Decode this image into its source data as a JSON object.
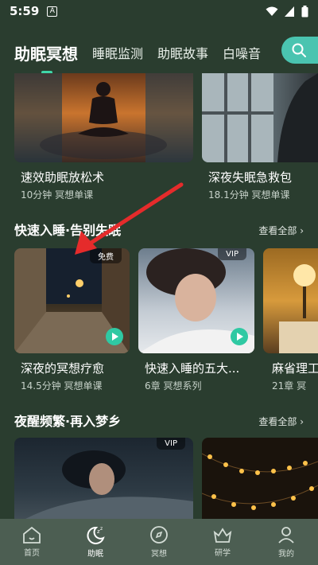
{
  "status": {
    "time": "5:59",
    "notif": "A"
  },
  "tabs": [
    {
      "label": "助眠冥想"
    },
    {
      "label": "睡眠监测"
    },
    {
      "label": "助眠故事"
    },
    {
      "label": "白噪音"
    }
  ],
  "top_cards": [
    {
      "title": "速效助眠放松术",
      "meta": "10分钟  冥想单课"
    },
    {
      "title": "深夜失眠急救包",
      "meta": "18.1分钟  冥想单课"
    }
  ],
  "section1": {
    "title": "快速入睡·告别失眠",
    "see_all": "查看全部",
    "cards": [
      {
        "title": "深夜的冥想疗愈",
        "meta": "14.5分钟  冥想单课",
        "badge": "免费"
      },
      {
        "title": "快速入睡的五大...",
        "meta": "6章  冥想系列",
        "badge": "VIP"
      },
      {
        "title": "麻省理工",
        "meta": "21章  冥",
        "badge": ""
      }
    ]
  },
  "section2": {
    "title": "夜醒频繁·再入梦乡",
    "see_all": "查看全部",
    "cards": [
      {
        "badge": "VIP"
      },
      {
        "badge": ""
      }
    ]
  },
  "nav": [
    {
      "label": "首页",
      "icon": "home-icon"
    },
    {
      "label": "助眠",
      "icon": "moon-icon"
    },
    {
      "label": "冥想",
      "icon": "compass-icon"
    },
    {
      "label": "研学",
      "icon": "crown-icon"
    },
    {
      "label": "我的",
      "icon": "user-icon"
    }
  ],
  "colors": {
    "background": "#2a3d2f",
    "accent": "#3fd6a8",
    "nav_bg": "#4c5e52",
    "arrow": "#e52b2b"
  }
}
